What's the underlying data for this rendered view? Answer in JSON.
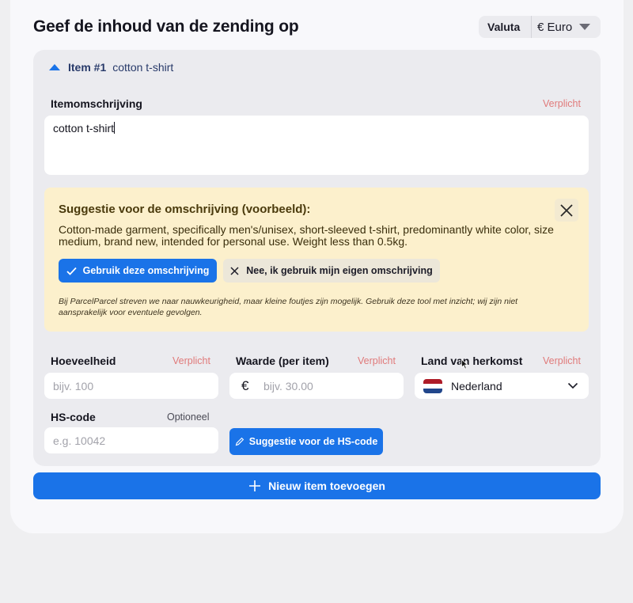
{
  "page": {
    "title": "Geef de inhoud van de zending op",
    "currency_label": "Valuta",
    "currency_value": "€ Euro"
  },
  "item": {
    "number": "Item #1",
    "name": "cotton t-shirt",
    "description_label": "Itemomschrijving",
    "required": "Verplicht",
    "optional": "Optioneel",
    "description_value": "cotton t-shirt"
  },
  "suggestion": {
    "title": "Suggestie voor de omschrijving (voorbeeld):",
    "text": "Cotton-made garment, specifically men's/unisex, short-sleeved t-shirt, predominantly white color, size medium, brand new, intended for personal use. Weight less than 0.5kg.",
    "accept_label": "Gebruik deze omschrijving",
    "reject_label": "Nee, ik gebruik mijn eigen omschrijving",
    "disclaimer": "Bij ParcelParcel streven we naar nauwkeurigheid, maar kleine foutjes zijn mogelijk. Gebruik deze tool met inzicht; wij zijn niet aansprakelijk voor eventuele gevolgen."
  },
  "fields": {
    "quantity_label": "Hoeveelheid",
    "quantity_placeholder": "bijv. 100",
    "value_label": "Waarde (per item)",
    "value_currency": "€",
    "value_placeholder": "bijv. 30.00",
    "origin_label": "Land van herkomst",
    "origin_value": "Nederland",
    "hs_label": "HS-code",
    "hs_placeholder": "e.g. 10042",
    "hs_suggest_label": "Suggestie voor de HS-code"
  },
  "actions": {
    "add_item_label": "Nieuw item toevoegen"
  },
  "colors": {
    "accent": "#1a73e8",
    "required": "#e07a7a",
    "suggestion_bg": "#fcf0cc"
  }
}
